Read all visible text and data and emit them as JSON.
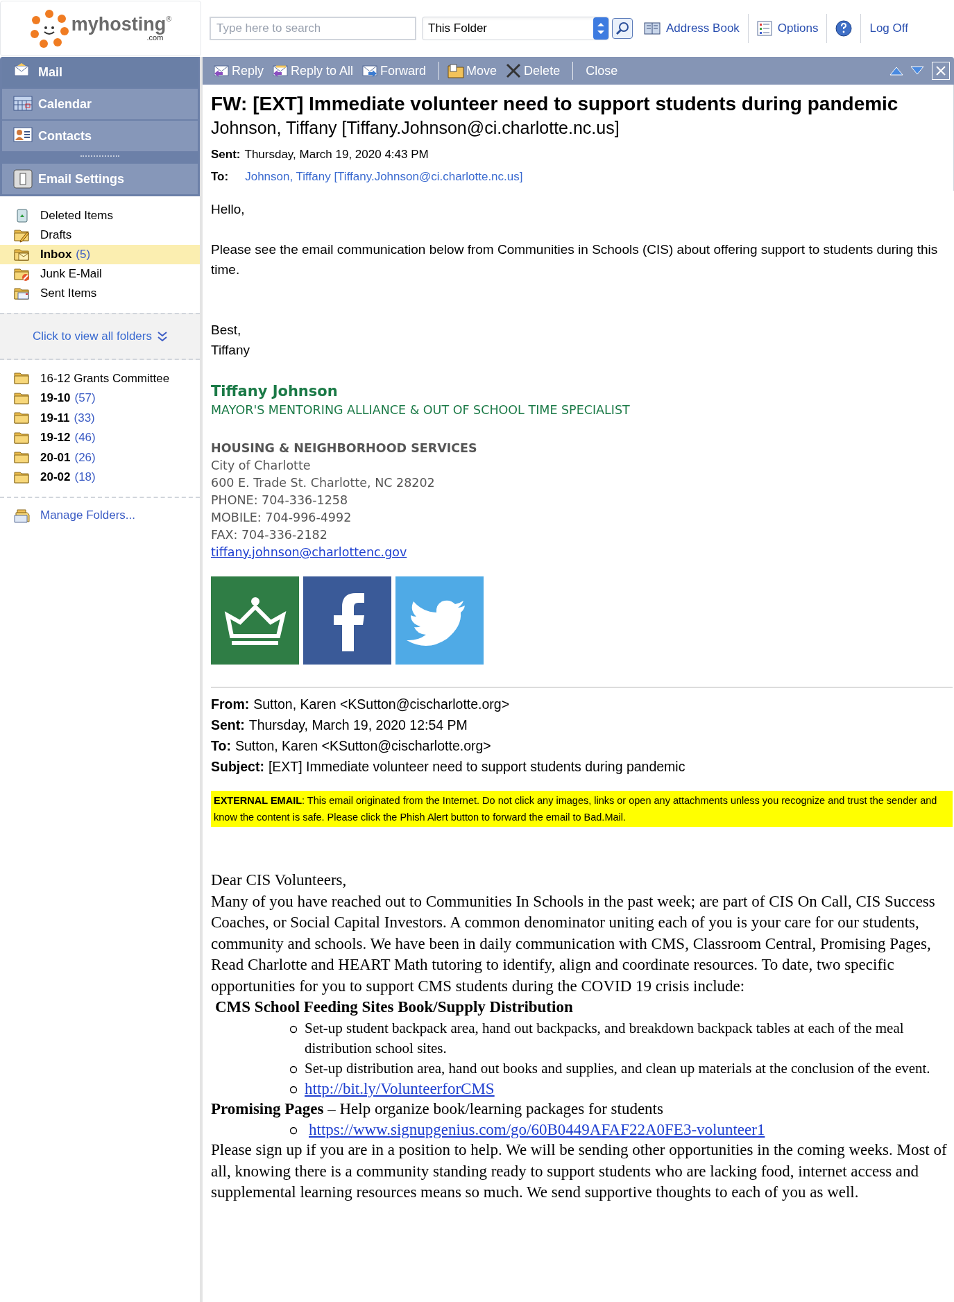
{
  "header": {
    "logo": {
      "name": "myhosting",
      "suffix": ".com",
      "mark": "®"
    },
    "search": {
      "placeholder": "Type here to search"
    },
    "scope": "This Folder",
    "links": [
      {
        "kind": "address",
        "label": "Address Book"
      },
      {
        "kind": "options",
        "label": "Options"
      },
      {
        "kind": "help"
      },
      {
        "kind": "logoff",
        "label": "Log Off"
      }
    ]
  },
  "nav": [
    {
      "kind": "mail",
      "label": "Mail",
      "selected": true
    },
    {
      "kind": "calendar",
      "label": "Calendar",
      "selected": false
    },
    {
      "kind": "contacts",
      "label": "Contacts",
      "selected": false
    },
    {
      "kind": "settings",
      "label": "Email Settings",
      "selected": false
    }
  ],
  "folders": [
    {
      "kind": "deleted",
      "name": "Deleted Items",
      "unread": false,
      "selected": false
    },
    {
      "kind": "drafts",
      "name": "Drafts",
      "unread": false,
      "selected": false
    },
    {
      "kind": "inbox",
      "name": "Inbox",
      "count": "(5)",
      "unread": true,
      "selected": true
    },
    {
      "kind": "junk",
      "name": "Junk E-Mail",
      "unread": false,
      "selected": false
    },
    {
      "kind": "sent",
      "name": "Sent Items",
      "unread": false,
      "selected": false
    }
  ],
  "view_all": "Click to view all folders",
  "custom_folders": [
    {
      "name": "16-12 Grants Committee",
      "unread": false
    },
    {
      "name": "19-10",
      "count": "(57)",
      "unread": true
    },
    {
      "name": "19-11",
      "count": "(33)",
      "unread": true
    },
    {
      "name": "19-12",
      "count": "(46)",
      "unread": true
    },
    {
      "name": "20-01",
      "count": "(26)",
      "unread": true
    },
    {
      "name": "20-02",
      "count": "(18)",
      "unread": true
    }
  ],
  "manage_folders": "Manage Folders...",
  "toolbar": [
    {
      "kind": "reply",
      "label": "Reply"
    },
    {
      "kind": "replyall",
      "label": "Reply to All"
    },
    {
      "kind": "forward",
      "label": "Forward"
    },
    {
      "kind": "move",
      "label": "Move"
    },
    {
      "kind": "delete",
      "label": "Delete"
    },
    {
      "kind": "close",
      "label": "Close"
    }
  ],
  "message": {
    "subject": "FW: [EXT] Immediate volunteer need to support students during pandemic",
    "sender": "Johnson, Tiffany [Tiffany.Johnson@ci.charlotte.nc.us]",
    "sent_label": "Sent:",
    "sent": "Thursday, March 19, 2020 4:43 PM",
    "to_label": "To:",
    "to": "Johnson, Tiffany [Tiffany.Johnson@ci.charlotte.nc.us]"
  },
  "body": {
    "greeting": "Hello,",
    "paragraph": "Please see the email communication below from Communities in Schools (CIS) about offering support to students during this time.",
    "closing": "Best,",
    "signoff": "Tiffany"
  },
  "signature": {
    "name": "Tiffany Johnson",
    "title": "MAYOR'S MENTORING ALLIANCE & OUT OF SCHOOL TIME SPECIALIST",
    "department": "HOUSING & NEIGHBORHOOD SERVICES",
    "lines": [
      "City of Charlotte",
      "600 E. Trade St. Charlotte, NC 28202",
      "PHONE: 704-336-1258",
      "MOBILE: 704-996-4992",
      "FAX: 704-336-2182"
    ],
    "email": "tiffany.johnson@charlottenc.gov"
  },
  "forwarded": [
    {
      "label": "From:",
      "value": "Sutton, Karen <KSutton@cischarlotte.org>"
    },
    {
      "label": "Sent:",
      "value": "Thursday, March 19, 2020 12:54 PM"
    },
    {
      "label": "To:",
      "value": "Sutton, Karen <KSutton@cischarlotte.org>"
    },
    {
      "label": "Subject:",
      "value": "[EXT] Immediate volunteer need to support students during pandemic"
    }
  ],
  "banner": "**EXTERNAL EMAIL**: This email originated from the Internet. Do not click any images, links or open any attachments unless you recognize and trust the sender and know the content is safe. Please click the Phish Alert button to forward the email to Bad.Mail.",
  "letter": {
    "salutation": "Dear CIS Volunteers,",
    "intro": "Many of you have reached out to Communities In Schools in the past week; are part of CIS On Call, CIS Success Coaches, or Social Capital Investors. A common denominator uniting each of you is your care for our students, community and schools. We have been in daily communication with CMS, Classroom Central, Promising Pages, Read Charlotte and HEART Math tutoring to identify, align and coordinate resources. To date, two specific opportunities for you to support CMS students during the COVID 19 crisis include:",
    "sections": [
      {
        "kind": "heading",
        "text": "CMS School Feeding Sites Book/Supply Distribution",
        "bullets": [
          {
            "kind": "text",
            "text": "Set-up student backpack area, hand out backpacks, and breakdown backpack tables at each of the meal distribution school sites."
          },
          {
            "kind": "text",
            "text": "Set-up distribution area, hand out books and supplies, and clean up materials at the conclusion of the event."
          },
          {
            "kind": "link",
            "text": "http://bit.ly/VolunteerforCMS"
          }
        ]
      },
      {
        "kind": "lead",
        "text": "**Promising Pages** – Help organize book/learning packages for students",
        "bullets": [
          {
            "kind": "link",
            "text": "https://www.signupgenius.com/go/60B0449AFAF22A0FE3-volunteer1"
          }
        ]
      }
    ],
    "outro": "Please sign up if you are in a position to help. We will be sending other opportunities in the coming weeks. Most of all, knowing there is a community standing ready to support students who are lacking food, internet access and supplemental learning resources means so much. We send supportive thoughts to each of you as well."
  }
}
